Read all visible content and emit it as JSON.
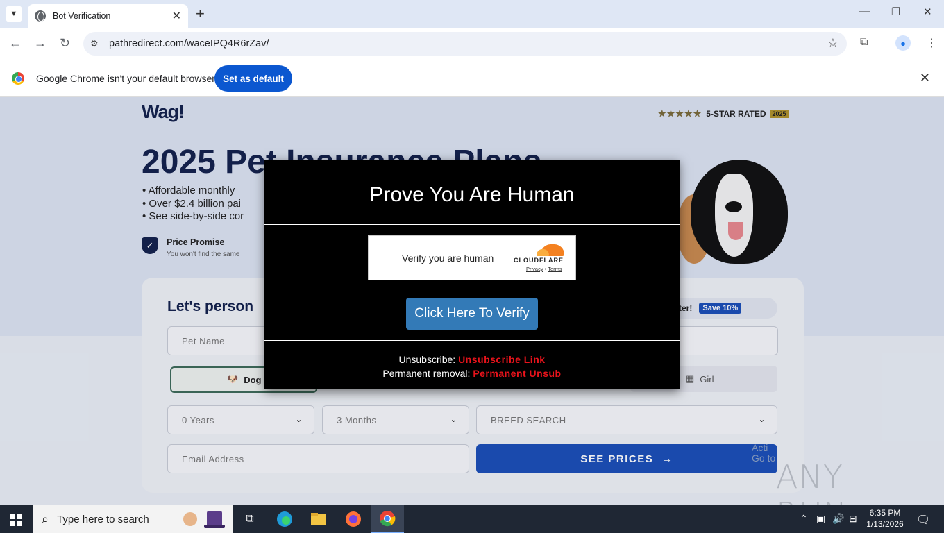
{
  "browser": {
    "tab_title": "Bot Verification",
    "url": "pathredirect.com/waceIPQ4R6rZav/",
    "infobar_text": "Google Chrome isn't your default browser",
    "set_default_label": "Set as default"
  },
  "page": {
    "logo": "Wag!",
    "rating_text": "5-STAR RATED",
    "rating_year": "2025",
    "headline": "2025 Pet Insurance Plans",
    "bullets": [
      "Affordable monthly",
      "Over $2.4 billion pai",
      "See side-by-side cor"
    ],
    "promise_title": "Price Promise",
    "promise_sub": "You won't find the same",
    "card_title": "Let's person",
    "later_text": "s later!",
    "save_badge": "Save 10%",
    "pet_name_placeholder": "Pet Name",
    "dog_label": "Dog",
    "girl_label": "Girl",
    "years_value": "0 Years",
    "months_value": "3 Months",
    "breed_placeholder": "BREED SEARCH",
    "email_placeholder": "Email Address",
    "see_prices_label": "SEE PRICES",
    "activate_line1": "Acti",
    "activate_line2": "Go to"
  },
  "modal": {
    "title": "Prove You Are Human",
    "cf_text": "Verify you are human",
    "cf_logo": "CLOUDFLARE",
    "cf_privacy": "Privacy",
    "cf_sep": " • ",
    "cf_terms": "Terms",
    "verify_label": "Click Here To Verify",
    "unsub_label": "Unsubscribe: ",
    "unsub_link": "Unsubscribe Link",
    "removal_label": "Permanent removal: ",
    "removal_link": "Permanent Unsub"
  },
  "watermark": "ANY RUN",
  "taskbar": {
    "search_placeholder": "Type here to search",
    "time": "6:35 PM",
    "date": "1/13/2026"
  }
}
